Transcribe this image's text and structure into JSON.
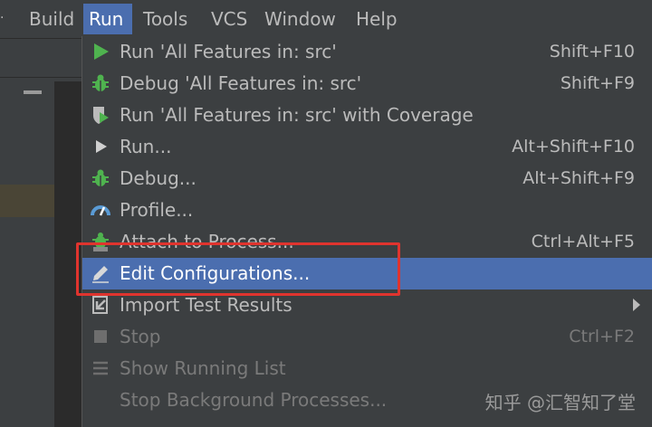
{
  "menubar": {
    "items": [
      {
        "label": "Build"
      },
      {
        "label": "Run"
      },
      {
        "label": "Tools"
      },
      {
        "label": "VCS"
      },
      {
        "label": "Window"
      },
      {
        "label": "Help"
      }
    ],
    "active_item": "Run",
    "active_color": "#4b6eaf"
  },
  "run_menu": {
    "items": [
      {
        "label": "Run 'All Features in: src'",
        "shortcut": "Shift+F10",
        "icon": "run-triangle-icon",
        "enabled": true
      },
      {
        "label": "Debug 'All Features in: src'",
        "shortcut": "Shift+F9",
        "icon": "debug-bug-icon",
        "enabled": true
      },
      {
        "label": "Run 'All Features in: src' with Coverage",
        "shortcut": "",
        "icon": "coverage-shield-icon",
        "enabled": true
      },
      {
        "label": "Run...",
        "shortcut": "Alt+Shift+F10",
        "icon": "run-icon",
        "enabled": true
      },
      {
        "label": "Debug...",
        "shortcut": "Alt+Shift+F9",
        "icon": "debug-icon",
        "enabled": true
      },
      {
        "label": "Profile...",
        "shortcut": "",
        "icon": "profile-gauge-icon",
        "enabled": true
      },
      {
        "label": "Attach to Process...",
        "shortcut": "Ctrl+Alt+F5",
        "icon": "attach-process-icon",
        "enabled": true
      },
      {
        "label": "Edit Configurations...",
        "shortcut": "",
        "icon": "edit-pencil-icon",
        "enabled": true,
        "selected": true
      },
      {
        "label": "Import Test Results",
        "shortcut": "",
        "icon": "import-results-icon",
        "enabled": true,
        "submenu": true
      },
      {
        "label": "Stop",
        "shortcut": "Ctrl+F2",
        "icon": "stop-square-icon",
        "enabled": false
      },
      {
        "label": "Show Running List",
        "shortcut": "",
        "icon": "running-list-icon",
        "enabled": false
      },
      {
        "label": "Stop Background Processes...",
        "shortcut": "",
        "icon": "",
        "enabled": false
      }
    ]
  },
  "annotation": {
    "highlight_color": "#e0342e",
    "highlighted_item": "Edit Configurations..."
  },
  "watermark": {
    "text": "知乎 @汇智知了堂"
  },
  "colors": {
    "background": "#3c3f41",
    "selection": "#4b6eaf",
    "run_green": "#4fb34f",
    "text": "#bbbbbb",
    "disabled_text": "#7a7a7a"
  }
}
